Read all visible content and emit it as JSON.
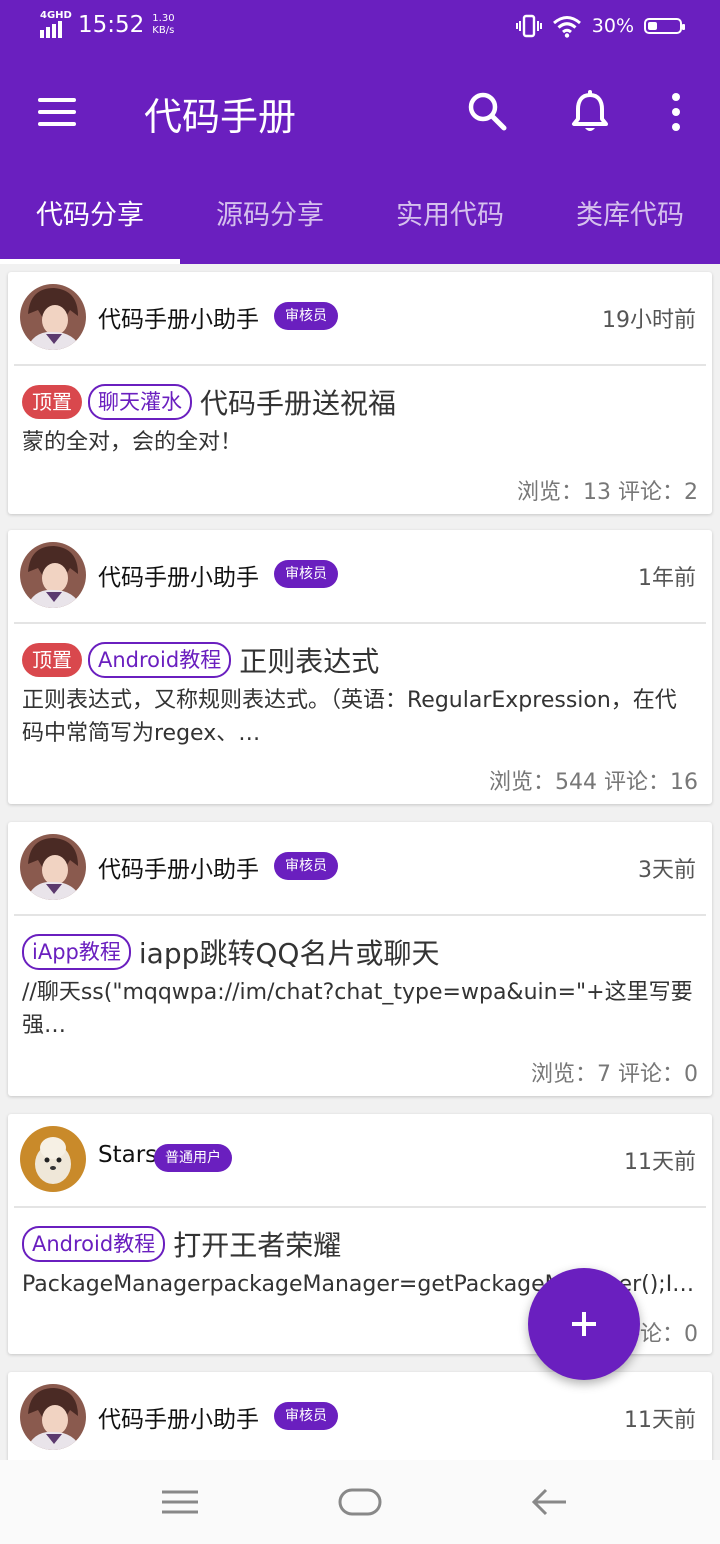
{
  "status_bar": {
    "network": "4GHD",
    "time": "15:52",
    "speed_value": "1.30",
    "speed_unit": "KB/s",
    "battery_percent": "30%",
    "battery_level": 0.3
  },
  "toolbar": {
    "title": "代码手册",
    "icons": [
      "menu-icon",
      "search-icon",
      "bell-icon",
      "more-vert-icon"
    ]
  },
  "tabs": [
    {
      "label": "代码分享",
      "active": true
    },
    {
      "label": "源码分享",
      "active": false
    },
    {
      "label": "实用代码",
      "active": false
    },
    {
      "label": "类库代码",
      "active": false
    }
  ],
  "posts": [
    {
      "author": "代码手册小助手",
      "role": "审核员",
      "time": "19小时前",
      "pinned": "顶置",
      "category": "聊天灌水",
      "title": "代码手册送祝福",
      "excerpt": "蒙的全对，会的全对！",
      "stats": "浏览：13  评论：2"
    },
    {
      "author": "代码手册小助手",
      "role": "审核员",
      "time": "1年前",
      "pinned": "顶置",
      "category": "Android教程",
      "title": "正则表达式",
      "excerpt": "正则表达式，又称规则表达式。（英语：RegularExpression，在代码中常简写为regex、…",
      "stats": "浏览：544  评论：16"
    },
    {
      "author": "代码手册小助手",
      "role": "审核员",
      "time": "3天前",
      "pinned": "",
      "category": "iApp教程",
      "title": "iapp跳转QQ名片或聊天",
      "excerpt": "//聊天ss(\"mqqwpa://im/chat?chat_type=wpa&uin=\"+这里写要强…",
      "stats": "浏览：7  评论：0"
    },
    {
      "author": "Stars",
      "role": "普通用户",
      "time": "11天前",
      "pinned": "",
      "category": "Android教程",
      "title": "打开王者荣耀",
      "excerpt": "PackageManagerpackageManager=getPackageManager();I…",
      "stats": "浏览：4  评论：0"
    },
    {
      "author": "代码手册小助手",
      "role": "审核员",
      "time": "11天前"
    }
  ],
  "fab": {
    "icon": "plus-icon"
  },
  "nav_bar": {
    "icons": [
      "recents-icon",
      "home-icon",
      "back-icon"
    ]
  },
  "colors": {
    "primary": "#6a1fbf",
    "pinned": "#d9484d"
  }
}
